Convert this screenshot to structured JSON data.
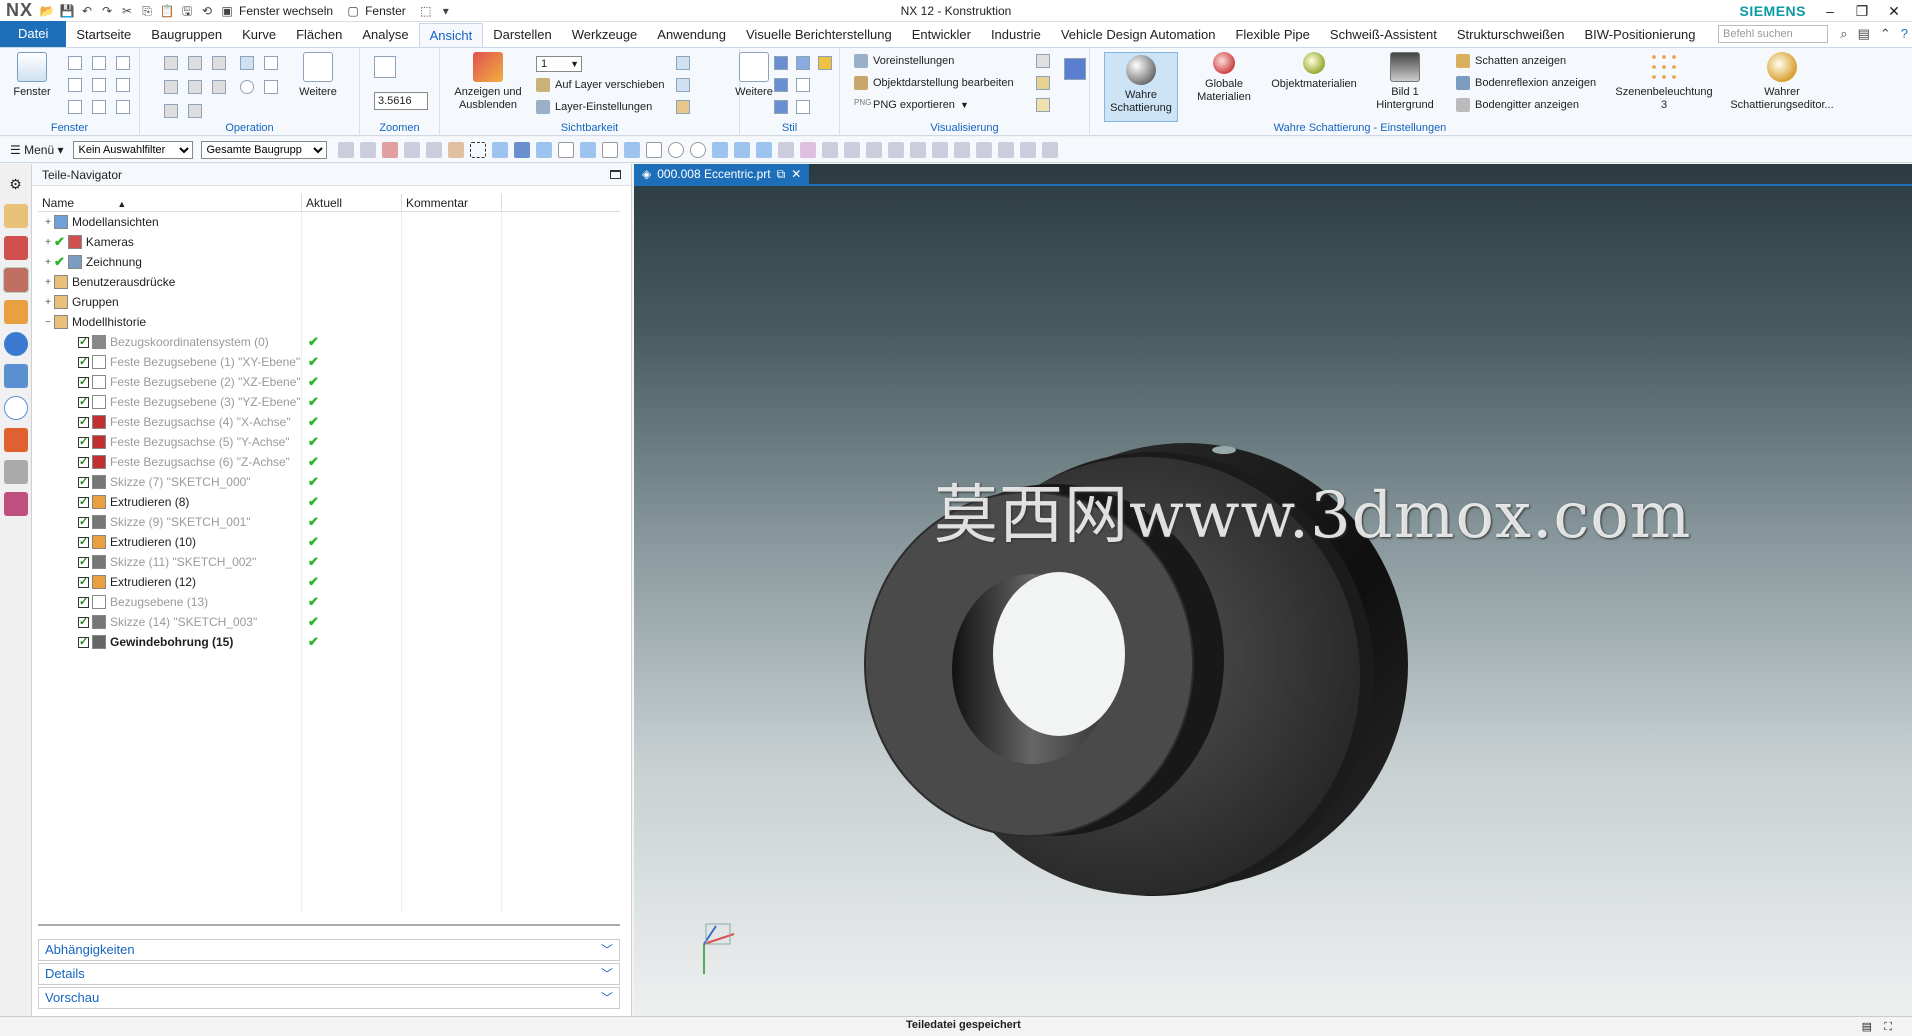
{
  "titlebar": {
    "logo": "NX",
    "switch_window": "Fenster wechseln",
    "window_menu": "Fenster",
    "title": "NX 12 - Konstruktion",
    "brand": "SIEMENS"
  },
  "tabs": [
    "Datei",
    "Startseite",
    "Baugruppen",
    "Kurve",
    "Flächen",
    "Analyse",
    "Ansicht",
    "Darstellen",
    "Werkzeuge",
    "Anwendung",
    "Visuelle Berichterstellung",
    "Entwickler",
    "Industrie",
    "Vehicle Design Automation",
    "Flexible Pipe",
    "Schweiß-Assistent",
    "Strukturschweißen",
    "BIW-Positionierung"
  ],
  "active_tab": "Ansicht",
  "search_placeholder": "Befehl suchen",
  "ribbon": {
    "groups": {
      "fenster": "Fenster",
      "operation": "Operation",
      "zoomen": "Zoomen",
      "sichtbarkeit": "Sichtbarkeit",
      "stil": "Stil",
      "visualisierung": "Visualisierung",
      "wahre": "Wahre Schattierung - Einstellungen"
    },
    "fenster_btn": "Fenster",
    "weitere": "Weitere",
    "zoom_value": "3.5616",
    "anzeigen": "Anzeigen und Ausblenden",
    "layer_value": "1",
    "auf_layer": "Auf Layer verschieben",
    "layer_einst": "Layer-Einstellungen",
    "weitere2": "Weitere",
    "voreinst": "Voreinstellungen",
    "objdarst": "Objektdarstellung bearbeiten",
    "png": "PNG exportieren",
    "wahre_schatt": "Wahre Schattierung",
    "globale": "Globale Materialien",
    "objmat": "Objektmaterialien",
    "bild": "Bild 1 Hintergrund",
    "schatten": "Schatten anzeigen",
    "bodenref": "Bodenreflexion anzeigen",
    "bodengitter": "Bodengitter anzeigen",
    "szene": "Szenenbeleuchtung 3",
    "wahrer_editor": "Wahrer Schattierungseditor..."
  },
  "selbar": {
    "menu": "Menü",
    "filter": "Kein Auswahlfilter",
    "scope": "Gesamte Baugrupp"
  },
  "navigator": {
    "title": "Teile-Navigator",
    "columns": [
      "Name",
      "Aktuell",
      "Kommentar"
    ],
    "rows": [
      {
        "label": "Modellansichten",
        "indent": 0,
        "exp": "+",
        "kind": "folder-views"
      },
      {
        "label": "Kameras",
        "indent": 0,
        "exp": "+",
        "kind": "camera",
        "check": true
      },
      {
        "label": "Zeichnung",
        "indent": 0,
        "exp": "+",
        "kind": "drawing",
        "check": true
      },
      {
        "label": "Benutzerausdrücke",
        "indent": 0,
        "exp": "+",
        "kind": "folder"
      },
      {
        "label": "Gruppen",
        "indent": 0,
        "exp": "+",
        "kind": "folder"
      },
      {
        "label": "Modellhistorie",
        "indent": 0,
        "exp": "−",
        "kind": "folder-open"
      },
      {
        "label": "Bezugskoordinatensystem (0)",
        "indent": 1,
        "kind": "csys",
        "dim": true,
        "cur": true
      },
      {
        "label": "Feste Bezugsebene (1) \"XY-Ebene\"",
        "indent": 1,
        "kind": "plane",
        "dim": true,
        "cur": true
      },
      {
        "label": "Feste Bezugsebene (2) \"XZ-Ebene\"",
        "indent": 1,
        "kind": "plane",
        "dim": true,
        "cur": true
      },
      {
        "label": "Feste Bezugsebene (3) \"YZ-Ebene\"",
        "indent": 1,
        "kind": "plane",
        "dim": true,
        "cur": true
      },
      {
        "label": "Feste Bezugsachse (4) \"X-Achse\"",
        "indent": 1,
        "kind": "axis",
        "dim": true,
        "cur": true
      },
      {
        "label": "Feste Bezugsachse (5) \"Y-Achse\"",
        "indent": 1,
        "kind": "axis",
        "dim": true,
        "cur": true
      },
      {
        "label": "Feste Bezugsachse (6) \"Z-Achse\"",
        "indent": 1,
        "kind": "axis",
        "dim": true,
        "cur": true
      },
      {
        "label": "Skizze (7) \"SKETCH_000\"",
        "indent": 1,
        "kind": "sketch",
        "dim": true,
        "cur": true
      },
      {
        "label": "Extrudieren (8)",
        "indent": 1,
        "kind": "extrude",
        "cur": true
      },
      {
        "label": "Skizze (9) \"SKETCH_001\"",
        "indent": 1,
        "kind": "sketch",
        "dim": true,
        "cur": true
      },
      {
        "label": "Extrudieren (10)",
        "indent": 1,
        "kind": "extrude",
        "cur": true
      },
      {
        "label": "Skizze (11) \"SKETCH_002\"",
        "indent": 1,
        "kind": "sketch",
        "dim": true,
        "cur": true
      },
      {
        "label": "Extrudieren (12)",
        "indent": 1,
        "kind": "extrude",
        "cur": true
      },
      {
        "label": "Bezugsebene (13)",
        "indent": 1,
        "kind": "plane",
        "dim": true,
        "cur": true
      },
      {
        "label": "Skizze (14) \"SKETCH_003\"",
        "indent": 1,
        "kind": "sketch",
        "dim": true,
        "cur": true
      },
      {
        "label": "Gewindebohrung (15)",
        "indent": 1,
        "kind": "thread",
        "bold": true,
        "cur": true
      }
    ],
    "panels": [
      "Abhängigkeiten",
      "Details",
      "Vorschau"
    ]
  },
  "document_tab": "000.008 Eccentric.prt",
  "watermark": "莫西网www.3dmox.com",
  "status": "Teiledatei gespeichert",
  "colors": {
    "accent": "#1e6fb9",
    "brand": "#0b9aa5",
    "check": "#2bb42b"
  }
}
